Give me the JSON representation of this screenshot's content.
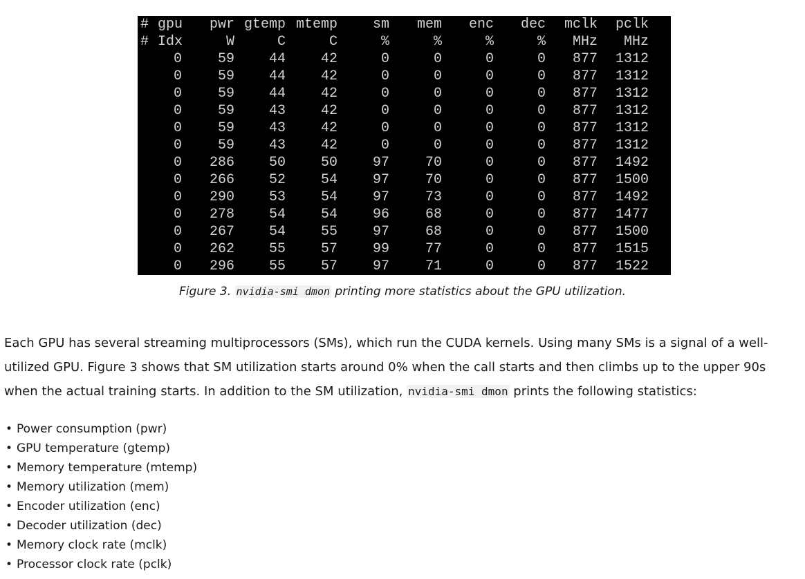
{
  "terminal": {
    "header_rows": [
      [
        "#",
        "gpu",
        "pwr",
        "gtemp",
        "mtemp",
        "sm",
        "mem",
        "enc",
        "dec",
        "mclk",
        "pclk"
      ],
      [
        "#",
        "Idx",
        "W",
        "C",
        "C",
        "%",
        "%",
        "%",
        "%",
        "MHz",
        "MHz"
      ]
    ],
    "rows": [
      [
        "0",
        "59",
        "44",
        "42",
        "0",
        "0",
        "0",
        "0",
        "877",
        "1312"
      ],
      [
        "0",
        "59",
        "44",
        "42",
        "0",
        "0",
        "0",
        "0",
        "877",
        "1312"
      ],
      [
        "0",
        "59",
        "44",
        "42",
        "0",
        "0",
        "0",
        "0",
        "877",
        "1312"
      ],
      [
        "0",
        "59",
        "43",
        "42",
        "0",
        "0",
        "0",
        "0",
        "877",
        "1312"
      ],
      [
        "0",
        "59",
        "43",
        "42",
        "0",
        "0",
        "0",
        "0",
        "877",
        "1312"
      ],
      [
        "0",
        "59",
        "43",
        "42",
        "0",
        "0",
        "0",
        "0",
        "877",
        "1312"
      ],
      [
        "0",
        "286",
        "50",
        "50",
        "97",
        "70",
        "0",
        "0",
        "877",
        "1492"
      ],
      [
        "0",
        "266",
        "52",
        "54",
        "97",
        "70",
        "0",
        "0",
        "877",
        "1500"
      ],
      [
        "0",
        "290",
        "53",
        "54",
        "97",
        "73",
        "0",
        "0",
        "877",
        "1492"
      ],
      [
        "0",
        "278",
        "54",
        "54",
        "96",
        "68",
        "0",
        "0",
        "877",
        "1477"
      ],
      [
        "0",
        "267",
        "54",
        "55",
        "97",
        "68",
        "0",
        "0",
        "877",
        "1500"
      ],
      [
        "0",
        "262",
        "55",
        "57",
        "99",
        "77",
        "0",
        "0",
        "877",
        "1515"
      ],
      [
        "0",
        "296",
        "55",
        "57",
        "97",
        "71",
        "0",
        "0",
        "877",
        "1522"
      ]
    ]
  },
  "caption": {
    "prefix": "Figure 3. ",
    "code": "nvidia-smi dmon",
    "suffix": " printing more statistics about the GPU utilization."
  },
  "paragraph": {
    "part1": "Each GPU has several streaming multiprocessors (SMs), which run the CUDA kernels. Using many SMs is a signal of a well-utilized GPU. Figure 3 shows that SM utilization starts around 0% when the call starts and then climbs up to the upper 90s when the actual training starts. In addition to the SM utilization, ",
    "code": "nvidia-smi dmon",
    "part2": " prints the following statistics:"
  },
  "bullets": [
    "Power consumption (pwr)",
    "GPU temperature (gtemp)",
    "Memory temperature (mtemp)",
    "Memory utilization (mem)",
    "Encoder utilization (enc)",
    "Decoder utilization (dec)",
    "Memory clock rate (mclk)",
    "Processor clock rate (pclk)"
  ]
}
